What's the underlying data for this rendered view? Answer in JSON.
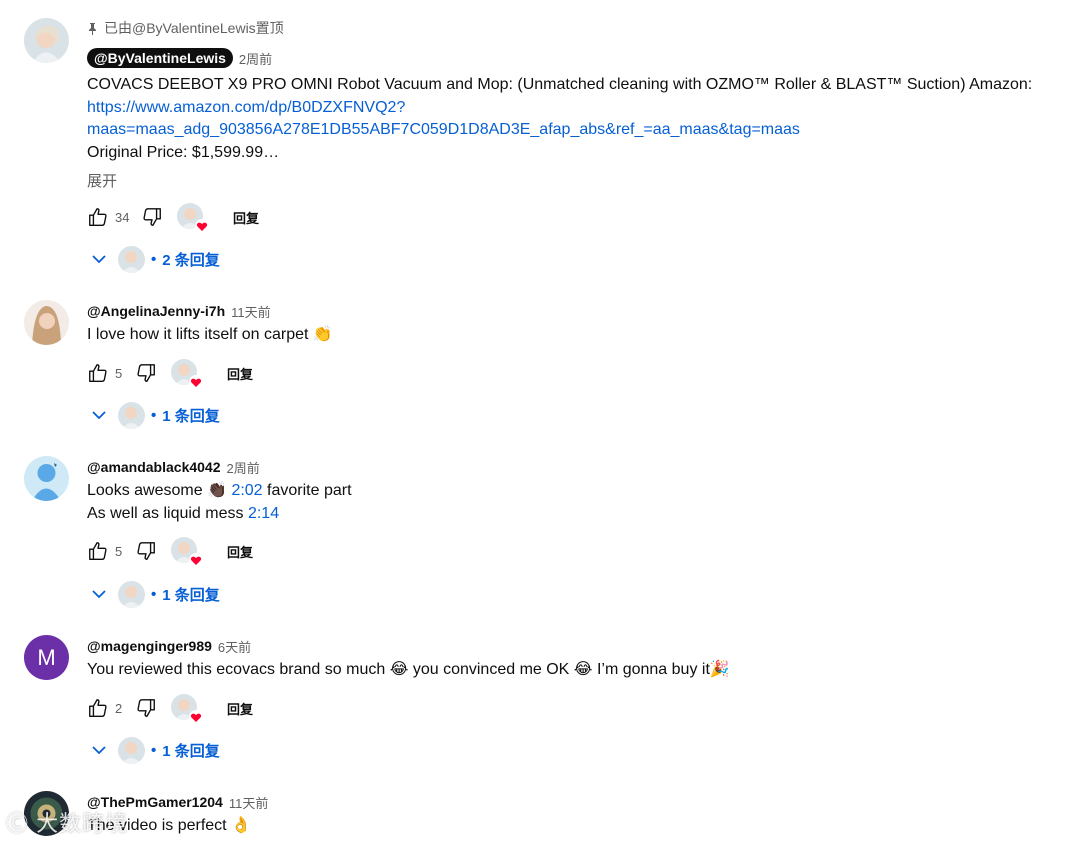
{
  "comments": [
    {
      "pinned_label": "已由@ByValentineLewis置顶",
      "author": "@ByValentineLewis",
      "time": "2周前",
      "line1": "COVACS DEEBOT X9 PRO OMNI Robot Vacuum and Mop: (Unmatched cleaning with OZMO™ Roller & BLAST™ Suction) Amazon:",
      "link1": "https://www.amazon.com/dp/B0DZXFNVQ2?",
      "link2": "maas=maas_adg_903856A278E1DB55ABF7C059D1D8AD3E_afap_abs&ref_=aa_maas&tag=maas",
      "line4": "Original Price: $1,599.99…",
      "expand": "展开",
      "likes": "34",
      "reply_label": "回复",
      "replies_label": "2 条回复"
    },
    {
      "author": "@AngelinaJenny-i7h",
      "time": "11天前",
      "text": "I love how it lifts itself on carpet 👏",
      "likes": "5",
      "reply_label": "回复",
      "replies_label": "1 条回复"
    },
    {
      "author": "@amandablack4042",
      "time": "2周前",
      "text_a": "Looks awesome 👏🏿 ",
      "ts1": "2:02",
      "text_b": " favorite part",
      "text_c": "As well as liquid mess ",
      "ts2": "2:14",
      "likes": "5",
      "reply_label": "回复",
      "replies_label": "1 条回复"
    },
    {
      "author": "@magenginger989",
      "time": "6天前",
      "avatar_letter": "M",
      "text": "You reviewed this ecovacs brand so much 😂  you convinced me OK 😂 I’m gonna buy it🎉",
      "likes": "2",
      "reply_label": "回复",
      "replies_label": "1 条回复"
    },
    {
      "author": "@ThePmGamer1204",
      "time": "11天前",
      "text": "The video is perfect 👌"
    }
  ],
  "watermark": "Ⓒ⁠ 大数跨境",
  "colors": {
    "link": "#065fd4",
    "meta": "#606060",
    "heart": "#ff0033",
    "avatar_m": "#6b2fa8"
  }
}
